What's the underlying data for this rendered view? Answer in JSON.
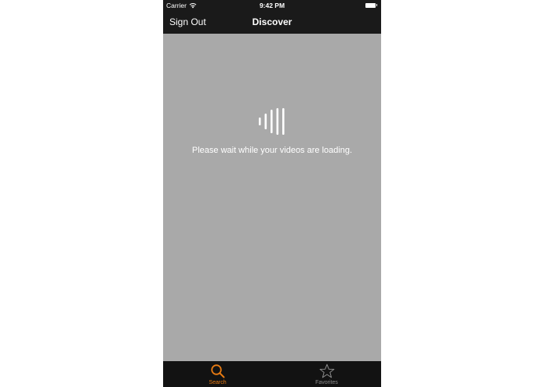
{
  "status_bar": {
    "carrier": "Carrier",
    "time": "9:42 PM"
  },
  "nav": {
    "left_button": "Sign Out",
    "title": "Discover"
  },
  "content": {
    "loading_message": "Please wait while your videos are loading."
  },
  "tabs": [
    {
      "label": "Search",
      "icon": "search-icon",
      "active": true
    },
    {
      "label": "Favorites",
      "icon": "star-icon",
      "active": false
    }
  ],
  "colors": {
    "accent": "#e87b12",
    "inactive_tab": "#8c8c8c",
    "bar_background": "#1a1a1a",
    "content_background": "#a9a9a9"
  }
}
